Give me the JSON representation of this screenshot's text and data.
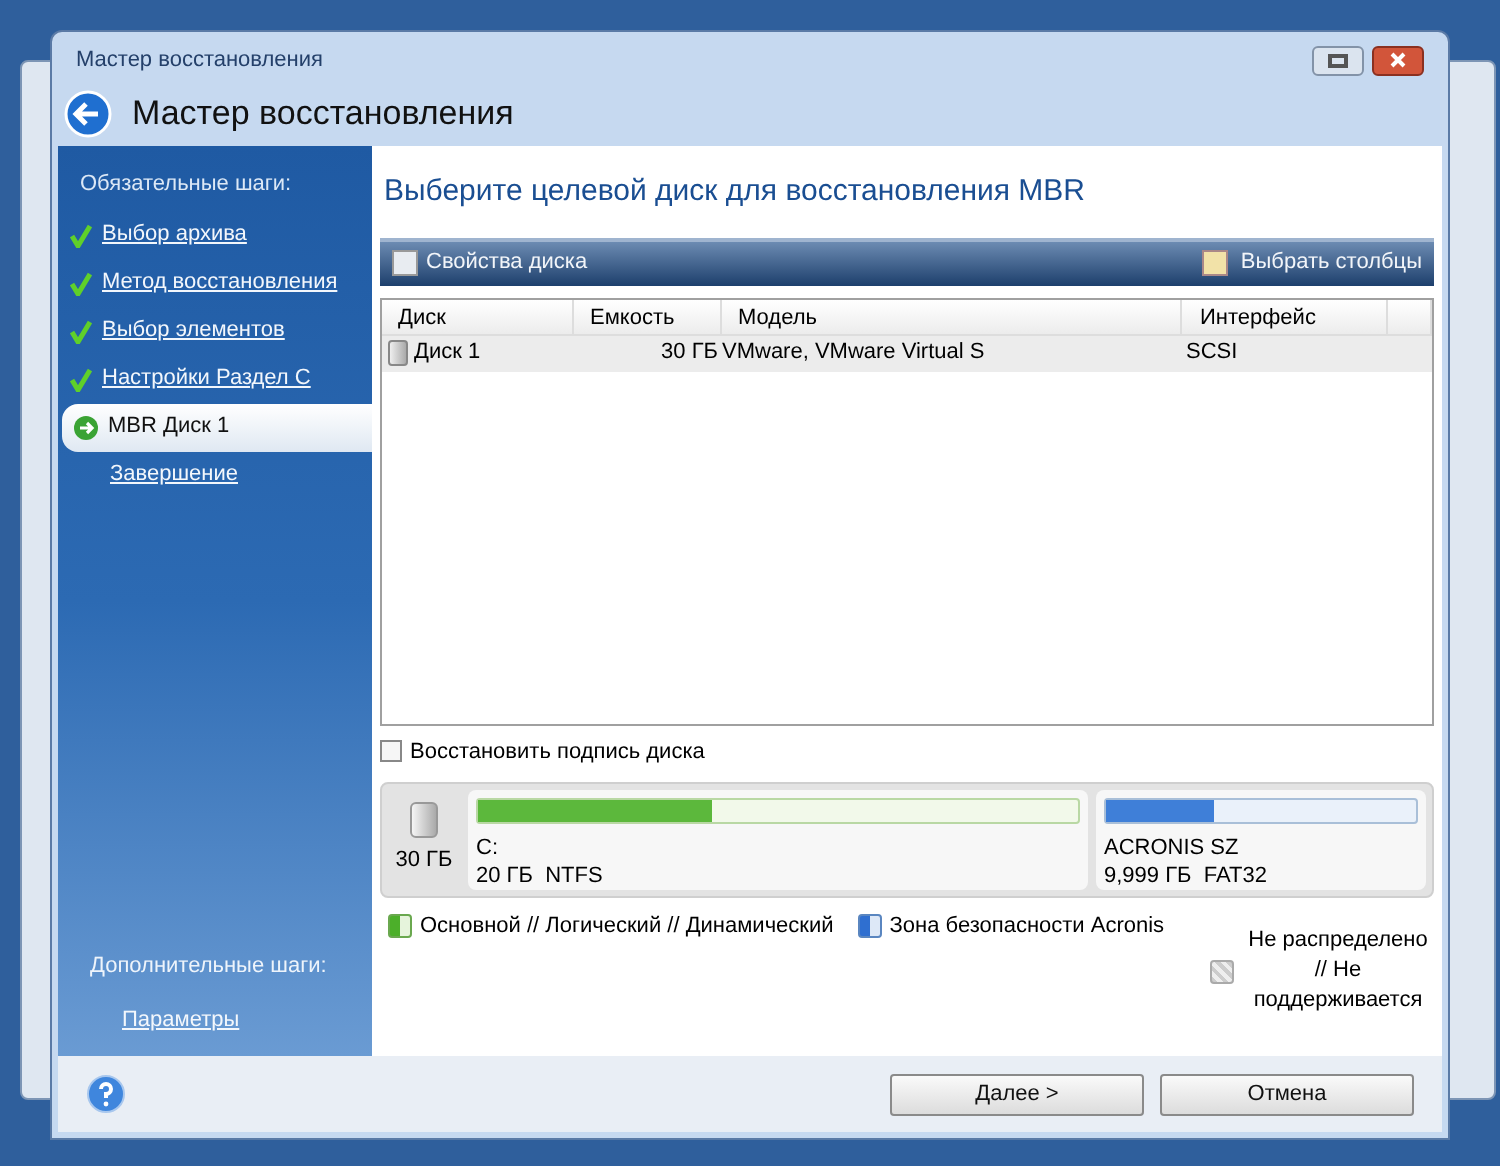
{
  "window": {
    "title": "Мастер восстановления",
    "header": "Мастер восстановления"
  },
  "sidebar": {
    "required_label": "Обязательные шаги:",
    "steps": [
      {
        "label": "Выбор архива",
        "kind": "done",
        "selected": false
      },
      {
        "label": "Метод восстановления",
        "kind": "done",
        "selected": false
      },
      {
        "label": "Выбор элементов",
        "kind": "done",
        "selected": false
      },
      {
        "label": "Настройки Раздел C",
        "kind": "done",
        "selected": false
      },
      {
        "label": "MBR Диск 1",
        "kind": "current",
        "selected": true
      },
      {
        "label": "Завершение",
        "kind": "pending",
        "selected": false
      }
    ],
    "optional_label": "Дополнительные шаги:",
    "optional_steps": [
      {
        "label": "Параметры"
      }
    ]
  },
  "main": {
    "heading": "Выберите целевой диск для восстановления MBR",
    "toolbar": {
      "left": "Свойства диска",
      "right": "Выбрать столбцы"
    },
    "table": {
      "columns": [
        "Диск",
        "Емкость",
        "Модель",
        "Интерфейс"
      ],
      "rows": [
        {
          "cells": [
            "Диск 1",
            "30 ГБ",
            "VMware, VMware Virtual S",
            "SCSI"
          ],
          "selected": true
        }
      ]
    },
    "checkbox": {
      "label": "Восстановить подпись диска",
      "checked": false
    },
    "disk_map": {
      "size": "30 ГБ",
      "partitions": [
        {
          "name": "C:",
          "info": "20 ГБ  NTFS",
          "kind": "primary",
          "level": 0.39
        },
        {
          "name": "ACRONIS SZ",
          "info": "9,999 ГБ  FAT32",
          "kind": "secure",
          "level": 0.35
        }
      ]
    },
    "legend": [
      {
        "label": "Основной // Логический // Динамический",
        "kind": "primary"
      },
      {
        "label": "Зона безопасности Acronis",
        "kind": "secure"
      },
      {
        "label": "Не распределено // Не поддерживается",
        "kind": "unallocated"
      }
    ]
  },
  "buttons": [
    "Далее >",
    "Отмена"
  ]
}
